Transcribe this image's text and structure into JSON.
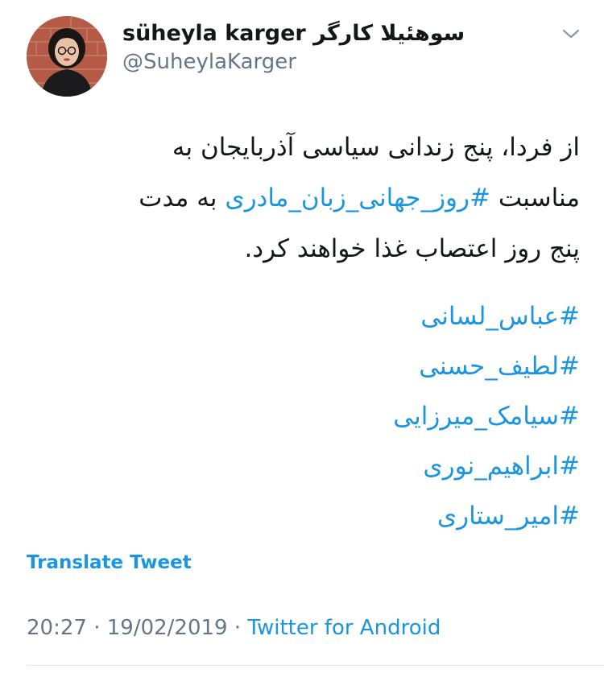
{
  "user": {
    "display_name": "süheyla karger سوهئیلا کارگر",
    "handle": "@SuheylaKarger"
  },
  "tweet": {
    "line_1": "از فردا، پنج زندانی سیاسی آذربایجان به",
    "line_2_prefix": "مناسبت ",
    "line_2_hashtag": "#روز_جهانی_زبان_مادری",
    "line_2_suffix": " به مدت",
    "line_3": "پنج روز اعتصاب غذا خواهند کرد.",
    "hashtags": [
      "#عباس_لسانی",
      "#لطیف_حسنی",
      "#سیامک_میرزایی",
      "#ابراهیم_نوری",
      "#امیر_ستاری"
    ]
  },
  "translate_label": "Translate Tweet",
  "meta": {
    "time": "20:27",
    "separator": " · ",
    "date": "19/02/2019",
    "source": "Twitter for Android"
  },
  "icons": {
    "menu": "chevron-down-icon",
    "avatar": "profile-avatar"
  },
  "colors": {
    "link": "#1b95e0",
    "secondary_text": "#657786",
    "primary_text": "#14171a",
    "divider": "#e1e8ed"
  }
}
